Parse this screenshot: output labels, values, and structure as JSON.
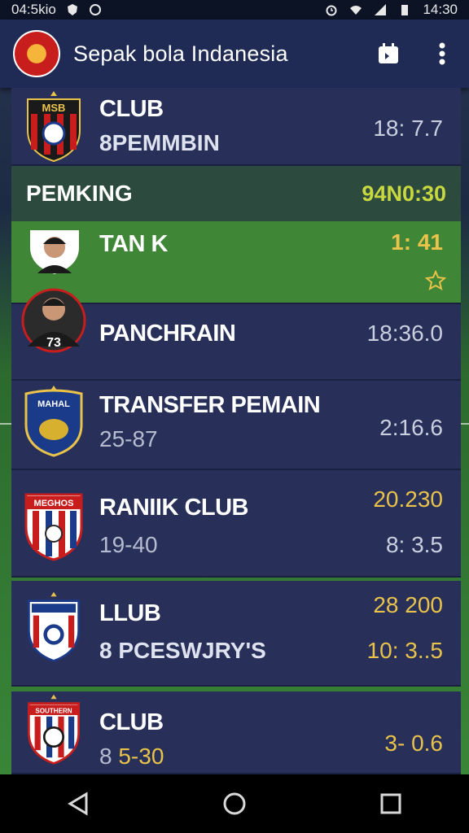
{
  "status_bar": {
    "left_text": "04:5kio",
    "time": "14:30"
  },
  "app_bar": {
    "title": "Sepak bola Indanesia",
    "actions": [
      "calendar-icon",
      "more-vert-icon"
    ]
  },
  "section": {
    "title": "PEMKING",
    "value": "94N0:30"
  },
  "cards": [
    {
      "name": "CLUB",
      "sub": "PEMMBIN",
      "time": "18: 7.7"
    },
    {
      "name": "TAN K",
      "time": "1: 41"
    },
    {
      "name": "PANCHRAIN",
      "time": "18:36.0"
    },
    {
      "name": "TRANSFER PEMAIN",
      "sub": "25-87",
      "time": "2:16.6"
    },
    {
      "name": "RANIIK CLUB",
      "sub": "19-40",
      "time_top": "20.230",
      "time": "8: 3.5"
    },
    {
      "name": "LLUB",
      "sub": "PCESWJRY'S",
      "time_top": "28 200",
      "time": "10: 3..5"
    },
    {
      "name": "CLUB",
      "sub": "5-30",
      "time": "3- 0.6"
    }
  ],
  "crests": {
    "first_label": "MSB",
    "transfer_label": "MAHAL",
    "ranik_label": "MEGHOS",
    "last_label": "SOUTHERN"
  },
  "avatar_number": "73",
  "colors": {
    "app_bar": "#1f2b55",
    "card": "#28305a",
    "highlight": "#3f8636",
    "gold": "#e8c24a"
  },
  "nav": [
    "back-icon",
    "home-icon",
    "recents-icon"
  ]
}
